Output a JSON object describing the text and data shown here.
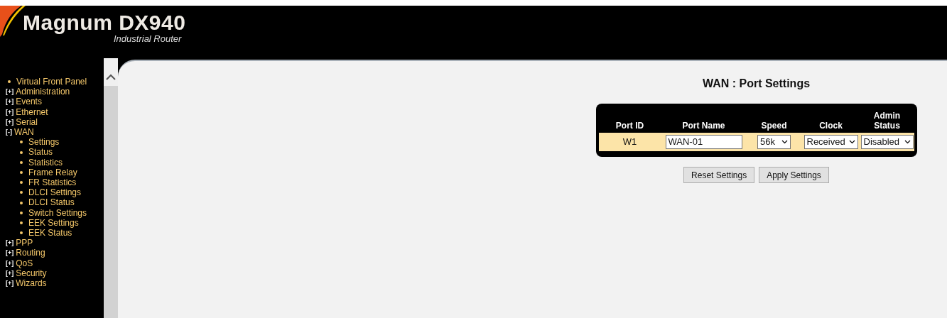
{
  "header": {
    "product": "Magnum DX940",
    "subtitle": "Industrial Router"
  },
  "sidebar": {
    "items": [
      {
        "kind": "link",
        "label": "Virtual Front Panel"
      },
      {
        "kind": "group",
        "marker": "[+]",
        "label": "Administration"
      },
      {
        "kind": "group",
        "marker": "[+]",
        "label": "Events"
      },
      {
        "kind": "group",
        "marker": "[+]",
        "label": "Ethernet"
      },
      {
        "kind": "group",
        "marker": "[+]",
        "label": "Serial"
      },
      {
        "kind": "group",
        "marker": "[-]",
        "label": "WAN",
        "children": [
          {
            "label": "Settings"
          },
          {
            "label": "Status"
          },
          {
            "label": "Statistics"
          },
          {
            "label": "Frame Relay"
          },
          {
            "label": "FR Statistics"
          },
          {
            "label": "DLCI Settings"
          },
          {
            "label": "DLCI Status"
          },
          {
            "label": "Switch Settings"
          },
          {
            "label": "EEK Settings"
          },
          {
            "label": "EEK Status"
          }
        ]
      },
      {
        "kind": "group",
        "marker": "[+]",
        "label": "PPP"
      },
      {
        "kind": "group",
        "marker": "[+]",
        "label": "Routing"
      },
      {
        "kind": "group",
        "marker": "[+]",
        "label": "QoS"
      },
      {
        "kind": "group",
        "marker": "[+]",
        "label": "Security"
      },
      {
        "kind": "group",
        "marker": "[+]",
        "label": "Wizards"
      }
    ]
  },
  "page": {
    "title": "WAN : Port Settings",
    "table": {
      "columns": [
        "Port ID",
        "Port Name",
        "Speed",
        "Clock",
        "Admin Status"
      ],
      "rows": [
        {
          "port_id": "W1",
          "port_name": "WAN-01",
          "speed": "56k",
          "clock": "Received",
          "admin_status": "Disabled"
        }
      ]
    },
    "buttons": [
      "Reset Settings",
      "Apply Settings"
    ]
  }
}
